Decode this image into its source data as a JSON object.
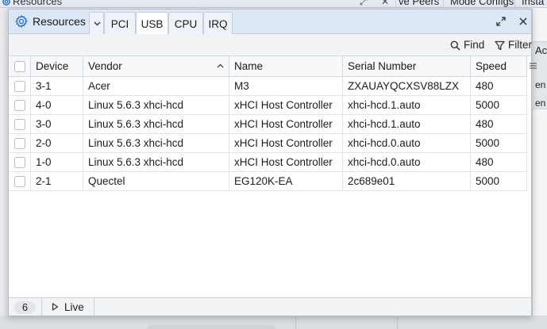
{
  "background": {
    "title": "Resources",
    "tabs": [
      "ve Peers",
      "Mode Configs",
      "Insta"
    ],
    "right_panel": [
      "Ac",
      "en",
      "en"
    ]
  },
  "dialog": {
    "title": "Resources",
    "tabs": [
      {
        "label": "PCI",
        "active": false
      },
      {
        "label": "USB",
        "active": true
      },
      {
        "label": "CPU",
        "active": false
      },
      {
        "label": "IRQ",
        "active": false
      }
    ],
    "toolbar": {
      "find_label": "Find",
      "filter_label": "Filter"
    },
    "table": {
      "columns": [
        "Device",
        "Vendor",
        "Name",
        "Serial Number",
        "Speed"
      ],
      "sorted_column": "Vendor",
      "rows": [
        {
          "device": "3-1",
          "vendor": "Acer",
          "name": "M3",
          "serial": "ZXAUAYQCXSV88LZX",
          "speed": "480"
        },
        {
          "device": "4-0",
          "vendor": "Linux 5.6.3 xhci-hcd",
          "name": "xHCI Host Controller",
          "serial": "xhci-hcd.1.auto",
          "speed": "5000"
        },
        {
          "device": "3-0",
          "vendor": "Linux 5.6.3 xhci-hcd",
          "name": "xHCI Host Controller",
          "serial": "xhci-hcd.1.auto",
          "speed": "480"
        },
        {
          "device": "2-0",
          "vendor": "Linux 5.6.3 xhci-hcd",
          "name": "xHCI Host Controller",
          "serial": "xhci-hcd.0.auto",
          "speed": "5000"
        },
        {
          "device": "1-0",
          "vendor": "Linux 5.6.3 xhci-hcd",
          "name": "xHCI Host Controller",
          "serial": "xhci-hcd.0.auto",
          "speed": "480"
        },
        {
          "device": "2-1",
          "vendor": "Quectel",
          "name": "EG120K-EA",
          "serial": "2c689e01",
          "speed": "5000"
        }
      ]
    },
    "status": {
      "count": "6",
      "live_label": "Live"
    }
  },
  "icons": {
    "title": "gear-icon",
    "tab_menu": "chevron-down-icon",
    "maximize": "maximize-icon",
    "close": "close-icon",
    "find": "search-icon",
    "filter": "filter-icon",
    "sort": "sort-ascending-icon",
    "column_menu": "hamburger-menu-icon",
    "live": "play-icon"
  },
  "colors": {
    "titlebar": "#dbe7f4",
    "accent": "#1f6fd1"
  }
}
